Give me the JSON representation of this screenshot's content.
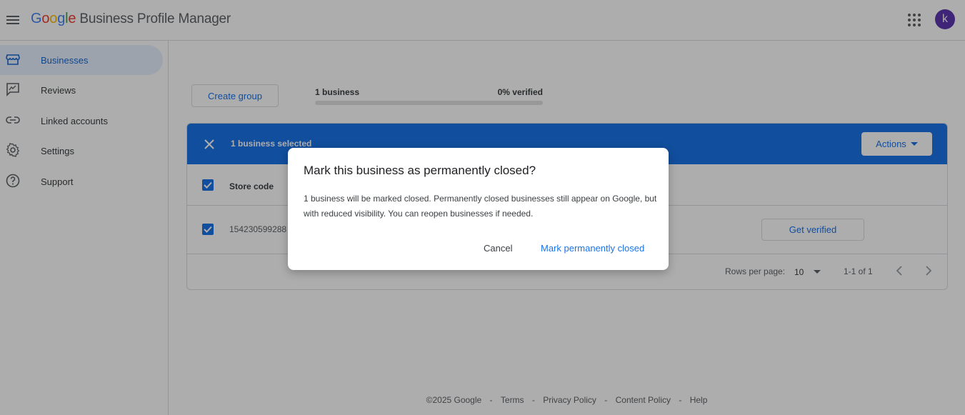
{
  "header": {
    "logo_letters": [
      "G",
      "o",
      "o",
      "g",
      "l",
      "e"
    ],
    "product_name": "Business Profile Manager",
    "avatar_initial": "k",
    "icons": {
      "menu": "menu-icon",
      "apps": "apps-grid-icon"
    }
  },
  "sidebar": {
    "items": [
      {
        "label": "Businesses",
        "icon": "storefront-icon",
        "active": true
      },
      {
        "label": "Reviews",
        "icon": "reviews-icon",
        "active": false
      },
      {
        "label": "Linked accounts",
        "icon": "link-icon",
        "active": false
      },
      {
        "label": "Settings",
        "icon": "gear-icon",
        "active": false
      },
      {
        "label": "Support",
        "icon": "help-icon",
        "active": false
      }
    ]
  },
  "main": {
    "create_group_label": "Create group",
    "business_count": "1 business",
    "verified_text": "0% verified",
    "verified_fraction": 0.0,
    "selection_bar": {
      "count_text": "1 business selected",
      "actions_label": "Actions",
      "color": "#1a73e8"
    },
    "table": {
      "header_store_code": "Store code",
      "rows": [
        {
          "store_code": "154230599288",
          "action_label": "Get verified",
          "checked": true
        }
      ]
    },
    "pagination": {
      "rows_per_page_label": "Rows per page:",
      "rows_per_page_value": "10",
      "range_text": "1-1 of 1"
    }
  },
  "footer": {
    "copyright": "©2025 Google",
    "separator": "-",
    "links": [
      "Terms",
      "Privacy Policy",
      "Content Policy",
      "Help"
    ]
  },
  "dialog": {
    "title": "Mark this business as permanently closed?",
    "body": "1 business will be marked closed. Permanently closed businesses still appear on Google, but with reduced visibility. You can reopen businesses if needed.",
    "cancel_label": "Cancel",
    "confirm_label": "Mark permanently closed"
  },
  "colors": {
    "accent": "#1a73e8",
    "avatar": "#5e35b1"
  }
}
